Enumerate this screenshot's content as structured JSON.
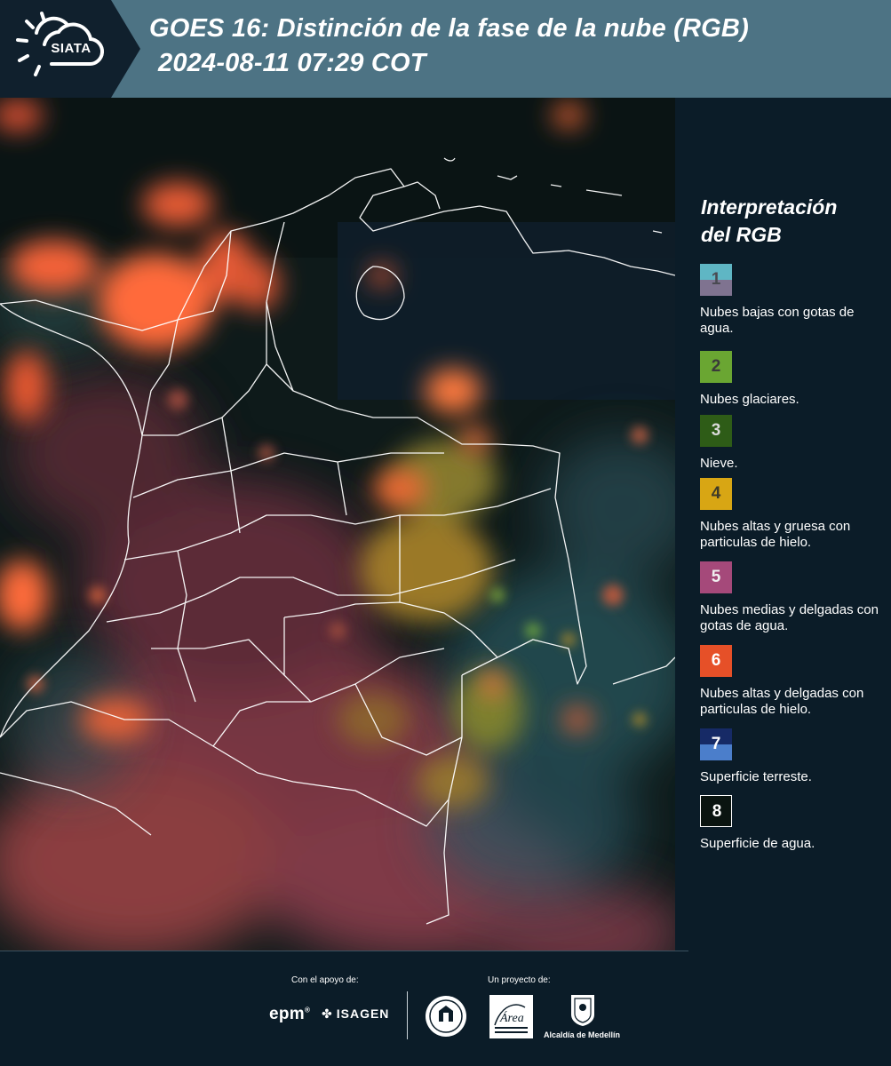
{
  "header": {
    "logo": "SIATA",
    "title_line1": "GOES 16: Distinción de la fase de la nube (RGB)",
    "title_line2": "2024-08-11 07:29 COT"
  },
  "legend": {
    "title_line1": "Interpretación",
    "title_line2": "del RGB",
    "items": [
      {
        "number": "1",
        "label": "Nubes bajas con gotas de agua.",
        "color_top": "#5fb6c4",
        "color_bottom": "#7f7390",
        "text_color": "#4a4a52"
      },
      {
        "number": "2",
        "label": "Nubes glaciares.",
        "color_top": "#6aa632",
        "color_bottom": "#6aa632",
        "text_color": "#3a3a3a"
      },
      {
        "number": "3",
        "label": "Nieve.",
        "color_top": "#2e5c17",
        "color_bottom": "#2e5c17",
        "text_color": "#d9d9d9"
      },
      {
        "number": "4",
        "label": "Nubes altas y gruesa con particulas de hielo.",
        "color_top": "#d8a614",
        "color_bottom": "#d8a614",
        "text_color": "#3d3a2a"
      },
      {
        "number": "5",
        "label": "Nubes medias y delgadas con gotas de agua.",
        "color_top": "#a5497a",
        "color_bottom": "#a5497a",
        "text_color": "#f0f0f0"
      },
      {
        "number": "6",
        "label": "Nubes altas y delgadas con particulas de hielo.",
        "color_top": "#e65028",
        "color_bottom": "#e65028",
        "text_color": "#ffffff"
      },
      {
        "number": "7",
        "label": "Superficie terreste.",
        "color_top": "#162a66",
        "color_bottom": "#4b7ecb",
        "text_color": "#ffffff"
      },
      {
        "number": "8",
        "label": "Superficie de agua.",
        "color_top": "#0a1410",
        "color_bottom": "#0a1410",
        "text_color": "#ffffff"
      }
    ]
  },
  "footer": {
    "support_label": "Con el apoyo de:",
    "project_label": "Un proyecto de:",
    "epm_logo": "epm",
    "isagen_logo": "ISAGEN",
    "area_logo": "Área",
    "alcaldia_logo": "Alcaldía de Medellín"
  },
  "colors": {
    "header_bg": "#4d7384",
    "logo_bg": "#10202d",
    "page_bg": "#0b1c28"
  }
}
